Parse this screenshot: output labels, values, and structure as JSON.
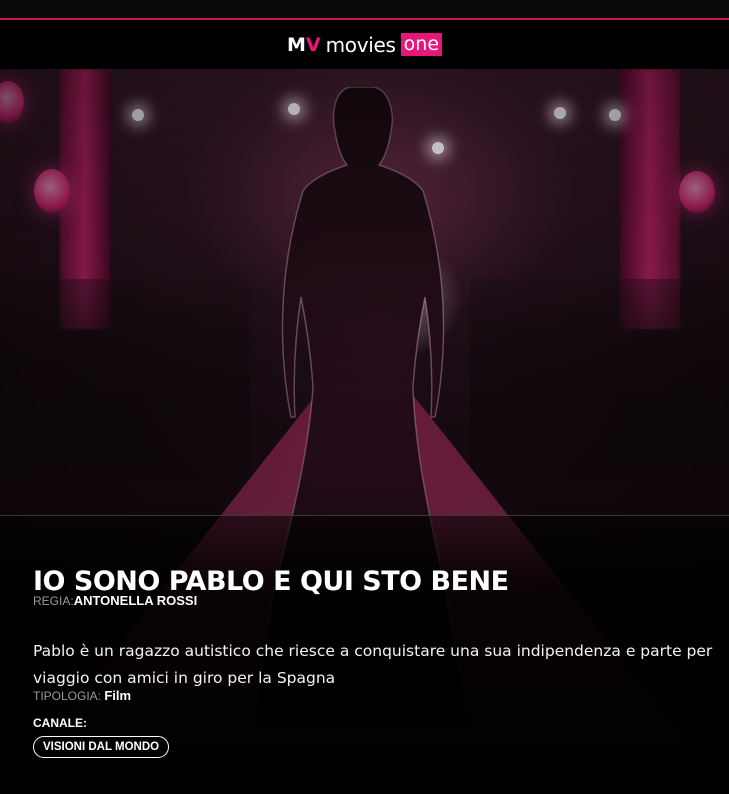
{
  "brand": {
    "logo_mark_m": "M",
    "logo_mark_v": "V",
    "logo_word": "movies",
    "logo_badge": "one",
    "accent_color": "#e6177a"
  },
  "hero": {
    "image_description": "silhouette-on-red-carpet"
  },
  "movie": {
    "title": "IO SONO PABLO E QUI STO BENE",
    "director_label": "REGIA:",
    "director": "ANTONELLA ROSSI",
    "description": "Pablo è un ragazzo autistico che riesce a conquistare una sua indipendenza e parte per viaggio con amici in giro per la Spagna",
    "type_label": "TIPOLOGIA:",
    "type": "Film",
    "channel_label": "CANALE:",
    "channel": "VISIONI DAL MONDO"
  }
}
